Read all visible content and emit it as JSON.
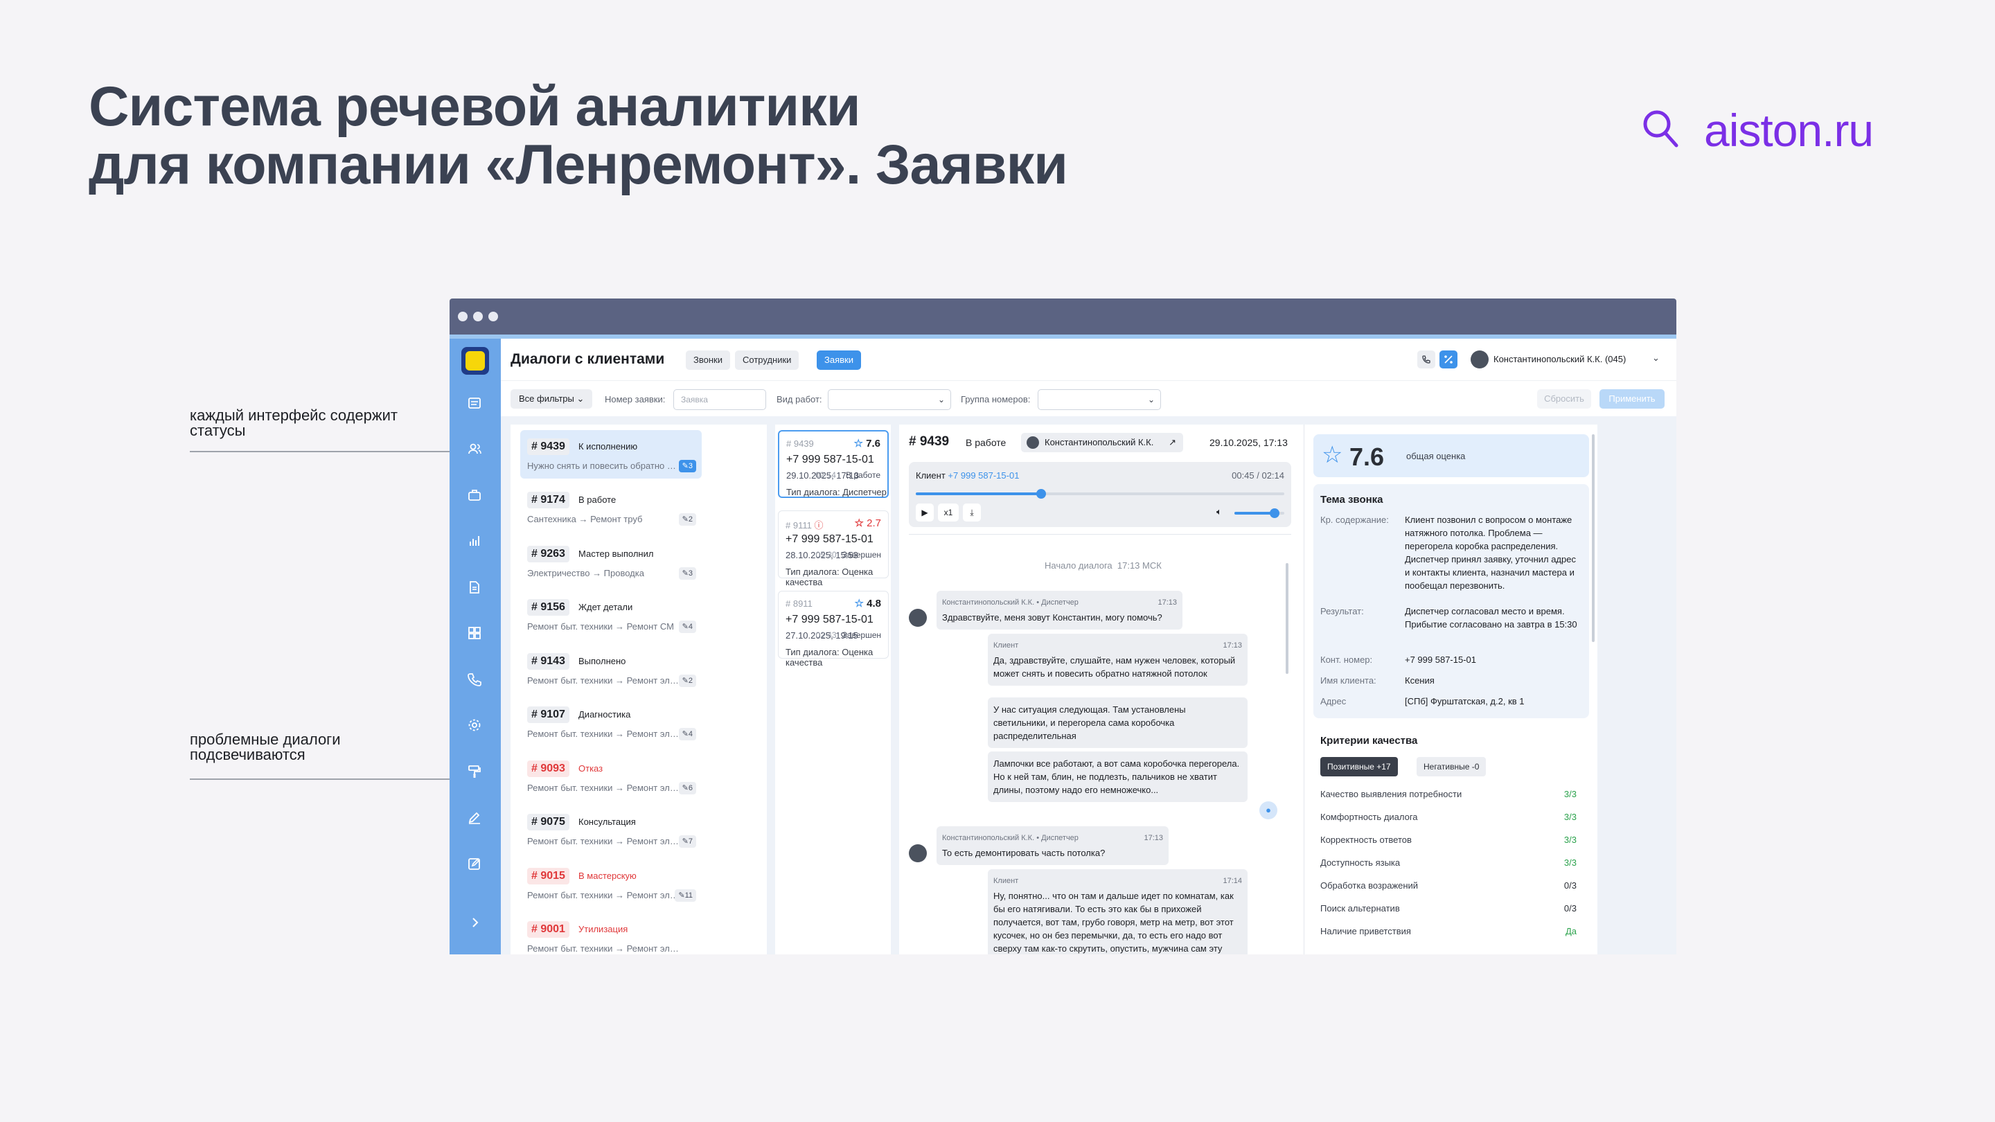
{
  "slide": {
    "title": "Система речевой аналитики\nдля компании «Ленремонт». Заявки",
    "brand": "aiston.ru",
    "brand_color": "#7b2fe6",
    "annotations": [
      {
        "text": "каждый интерфейс содержит\nстатусы"
      },
      {
        "text": "проблемные диалоги\nподсвечиваются"
      }
    ]
  },
  "app": {
    "title": "Диалоги с клиентами",
    "tabs": [
      {
        "label": "Звонки"
      },
      {
        "label": "Сотрудники"
      },
      {
        "label": "Заявки",
        "active": true
      }
    ],
    "user": "Константинопольский К.К. (045)",
    "accent": "#3d92ea",
    "sidebar_icons": [
      "list-icon",
      "users-icon",
      "briefcase-icon",
      "chart-icon",
      "document-icon",
      "grid-icon",
      "phone-icon",
      "gear-icon",
      "paint-roller-icon",
      "pen-icon",
      "edit-icon",
      "chevron-right-icon"
    ]
  },
  "filters": {
    "all_filters": "Все фильтры",
    "req_number_label": "Номер заявки:",
    "req_number_placeholder": "Заявка",
    "work_type_label": "Вид работ:",
    "group_label": "Группа номеров:",
    "reset": "Сбросить",
    "apply": "Применить"
  },
  "requests": [
    {
      "num": "# 9439",
      "status": "К исполнению",
      "sub": "Нужно снять и повесить обратно нав...",
      "count": "3",
      "active": true
    },
    {
      "num": "# 9174",
      "status": "В работе",
      "sub": "Сантехника → Ремонт труб",
      "count": "2"
    },
    {
      "num": "# 9263",
      "status": "Мастер выполнил",
      "sub": "Электричество → Проводка",
      "count": "3"
    },
    {
      "num": "# 9156",
      "status": "Ждет детали",
      "sub": "Ремонт быт. техники → Ремонт СМ",
      "count": "4"
    },
    {
      "num": "# 9143",
      "status": "Выполнено",
      "sub": "Ремонт быт. техники → Ремонт элект...",
      "count": "2"
    },
    {
      "num": "# 9107",
      "status": "Диагностика",
      "sub": "Ремонт быт. техники → Ремонт элект...",
      "count": "4"
    },
    {
      "num": "# 9093",
      "status": "Отказ",
      "sub": "Ремонт быт. техники → Ремонт элект...",
      "count": "6",
      "problem": true
    },
    {
      "num": "# 9075",
      "status": "Консультация",
      "sub": "Ремонт быт. техники → Ремонт элект...",
      "count": "7"
    },
    {
      "num": "# 9015",
      "status": "В мастерскую",
      "sub": "Ремонт быт. техники → Ремонт элект...",
      "count": "11",
      "problem": true
    },
    {
      "num": "# 9001",
      "status": "Утилизация",
      "sub": "Ремонт быт. техники → Ремонт элект...",
      "count": "",
      "problem": true
    }
  ],
  "calls": [
    {
      "id": "# 9439",
      "rating": "7.6",
      "phone": "+7 999 587-15-01",
      "date": "29.10.2025, 17:13",
      "duration": "02:14",
      "status": "В работе",
      "type": "Тип диалога: Диспетчер",
      "active": true
    },
    {
      "id": "# 9111",
      "rating": "2.7",
      "phone": "+7 999 587-15-01",
      "date": "28.10.2025, 15:53",
      "duration": "05:30",
      "status": "Завершен",
      "type": "Тип диалога: Оценка качества",
      "alert": true
    },
    {
      "id": "# 8911",
      "rating": "4.8",
      "phone": "+7 999 587-15-01",
      "date": "27.10.2025, 19:15",
      "duration": "02:43",
      "status": "Завершен",
      "type": "Тип диалога: Оценка качества"
    }
  ],
  "dialog": {
    "num": "# 9439",
    "status": "В работе",
    "operator": "Константинопольский К.К.",
    "datetime": "29.10.2025, 17:13",
    "player": {
      "label": "Клиент",
      "phone": "+7 999 587-15-01",
      "time": "00:45 / 02:14",
      "speed": "x1",
      "progress": 0.34,
      "volume": 0.8
    },
    "start": "Начало диалога",
    "start_time": "17:13 МСК",
    "messages": [
      {
        "author": "Константинопольский К.К. • Диспетчер",
        "time": "17:13",
        "text": "Здравствуйте, меня зовут Константин, могу помочь?",
        "side": "left"
      },
      {
        "author": "Клиент",
        "time": "17:13",
        "text": "Да, здравствуйте, слушайте, нам нужен человек, который может снять и повесить обратно натяжной потолок",
        "side": "right"
      },
      {
        "author": "",
        "time": "",
        "text": "У нас ситуация следующая. Там установлены светильники, и перегорела сама коробочка распределительная",
        "side": "right"
      },
      {
        "author": "",
        "time": "",
        "text": "Лампочки все работают, а вот сама коробочка перегорела. Но к ней там, блин, не подлезть, пальчиков не хватит длины, поэтому надо его немножечко...",
        "side": "right"
      },
      {
        "author": "Константинопольский К.К. • Диспетчер",
        "time": "17:13",
        "text": "То есть демонтировать часть потолка?",
        "side": "left"
      },
      {
        "author": "Клиент",
        "time": "17:14",
        "text": "Ну, понятно... что он там и дальше идет по комнатам, как бы его натягивали. То есть это как бы в прихожей получается, вот там, грубо говоря, метр на метр, вот этот кусочек, но он без перемычки, да, то есть его надо вот сверху там как-то скрутить, опустить, мужчина сам эту коробочку поменяет, ну, чтобы лампочки как бы",
        "side": "right"
      }
    ]
  },
  "summary": {
    "score": "7.6",
    "score_label": "общая оценка",
    "topic_title": "Тема звонка",
    "rows": [
      {
        "label": "Кр. содержание:",
        "value": "Клиент позвонил с вопросом о монтаже натяжного потолка. Проблема — перегорела коробка распределения. Диспетчер принял заявку, уточнил адрес и контакты клиента, назначил мастера и пообещал перезвонить."
      },
      {
        "label": "Результат:",
        "value": "Диспетчер согласовал место и время. Прибытие согласовано на завтра в 15:30"
      },
      {
        "label": "Конт. номер:",
        "value": "+7 999 587-15-01"
      },
      {
        "label": "Имя клиента:",
        "value": "Ксения"
      },
      {
        "label": "Адрес",
        "value": "[СПб] Фурштатская, д.2, кв 1"
      }
    ],
    "criteria_title": "Критерии качества",
    "positive": "Позитивные  +17",
    "negative": "Негативные  -0",
    "criteria": [
      {
        "name": "Качество выявления потребности",
        "value": "3/3",
        "ok": true
      },
      {
        "name": "Комфортность диалога",
        "value": "3/3",
        "ok": true
      },
      {
        "name": "Корректность ответов",
        "value": "3/3",
        "ok": true
      },
      {
        "name": "Доступность языка",
        "value": "3/3",
        "ok": true
      },
      {
        "name": "Обработка возражений",
        "value": "0/3",
        "ok": false
      },
      {
        "name": "Поиск альтернатив",
        "value": "0/3",
        "ok": false
      },
      {
        "name": "Наличие приветствия",
        "value": "Да",
        "ok": true
      }
    ]
  }
}
